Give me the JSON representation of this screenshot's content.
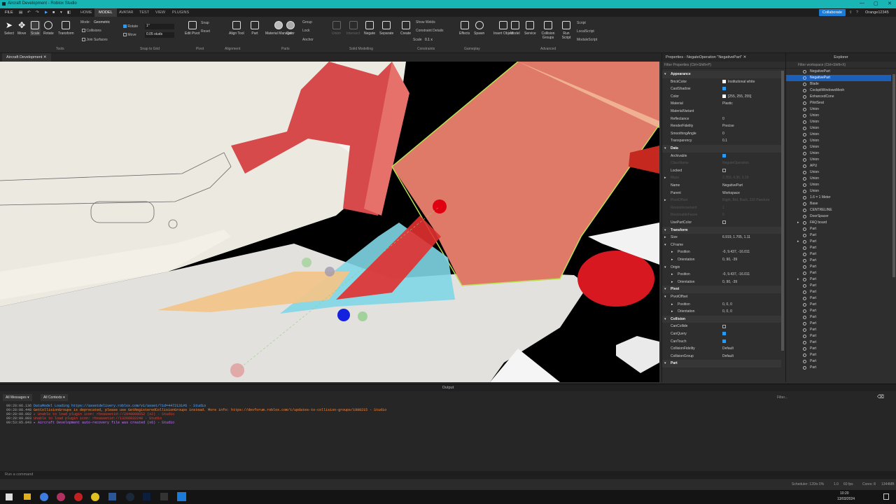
{
  "window": {
    "title": "Aircraft Development - Roblox Studio"
  },
  "menu": {
    "file": "FILE",
    "items": [
      "HOME",
      "MODEL",
      "AVATAR",
      "TEST",
      "VIEW",
      "PLUGINS"
    ],
    "active": "MODEL",
    "collaborate": "Collaborate",
    "user": "Orange12345"
  },
  "ribbon": {
    "tools": [
      "Select",
      "Move",
      "Scale",
      "Rotate",
      "Transform"
    ],
    "mode_label": "Mode:",
    "mode_value": "Geometric",
    "collisions": "Collisions",
    "join_surfaces": "Join Surfaces",
    "rotate_label": "Rotate",
    "rotate_value": "1°",
    "move_label": "Move",
    "move_value": "0.05 studs",
    "edit_pivot": "Edit Pivot",
    "snap": "Snap",
    "reset": "Reset",
    "align_tool": "Align Tool",
    "part": "Part",
    "material_manager": "Material Manager",
    "color": "Color",
    "group": "Group",
    "lock": "Lock",
    "anchor": "Anchor",
    "union": "Union",
    "intersect": "Intersect",
    "negate": "Negate",
    "separate": "Separate",
    "create": "Create",
    "show_welds": "Show Welds",
    "constraint_details": "Constraint Details",
    "scale_label": "Scale",
    "scale_value": "0.1 x",
    "effects": "Effects",
    "spawn": "Spawn",
    "insert_object": "Insert Object",
    "model": "Model",
    "service": "Service",
    "collision_groups": "Collision Groups",
    "run_script": "Run Script",
    "script": "Script",
    "local_script": "LocalScript",
    "module_script": "ModuleScript",
    "groups": [
      "Tools",
      "Snap to Grid",
      "Pivot",
      "Alignment",
      "Parts",
      "Solid Modelling",
      "Constraints",
      "Gameplay",
      "Advanced"
    ]
  },
  "viewport": {
    "tab": "Aircraft Development"
  },
  "properties": {
    "title": "Properties - NegateOperation \"NegativePart\"",
    "filter": "Filter Properties (Ctrl+Shift+P)",
    "rows": [
      {
        "t": "sec",
        "n": "Appearance"
      },
      {
        "n": "BrickColor",
        "v": "Institutional white",
        "sw": "#ffffff"
      },
      {
        "n": "CastShadow",
        "c": true
      },
      {
        "n": "Color",
        "v": "[255, 255, 255]",
        "sw": "#ffffff"
      },
      {
        "n": "Material",
        "v": "Plastic"
      },
      {
        "n": "MaterialVariant",
        "v": ""
      },
      {
        "n": "Reflectance",
        "v": "0"
      },
      {
        "n": "RenderFidelity",
        "v": "Precise"
      },
      {
        "n": "SmoothingAngle",
        "v": "0"
      },
      {
        "n": "Transparency",
        "v": "0.1"
      },
      {
        "t": "sec",
        "n": "Data"
      },
      {
        "n": "Archivable",
        "c": true
      },
      {
        "n": "ClassName",
        "v": "NegateOperation",
        "dim": true
      },
      {
        "n": "Locked",
        "c": false
      },
      {
        "n": "Mass",
        "v": "2.353, 4.36, 3.19",
        "dim": true,
        "x": true
      },
      {
        "n": "Name",
        "v": "NegativePart"
      },
      {
        "n": "Parent",
        "v": "Workspace"
      },
      {
        "n": "PivotOffset",
        "v": "Right, Bot, Back, 226 Pandora",
        "dim": true,
        "x": true
      },
      {
        "n": "ResizeIncrement",
        "v": "1",
        "dim": true
      },
      {
        "n": "ResizeableFaces",
        "v": "0",
        "dim": true
      },
      {
        "n": "UsePartColor",
        "c": false
      },
      {
        "t": "sec",
        "n": "Transform"
      },
      {
        "n": "Size",
        "v": "6.919, 1.705, 1.11",
        "x": true
      },
      {
        "n": "CFrame",
        "v": "",
        "x": true,
        "open": true
      },
      {
        "n": "Position",
        "v": "-0, 9.437, -16.011",
        "sub": true
      },
      {
        "n": "Orientation",
        "v": "0, 90, -39",
        "sub": true
      },
      {
        "n": "Origin",
        "v": "",
        "x": true,
        "open": true
      },
      {
        "n": "Position",
        "v": "-0, 9.437, -16.011",
        "sub": true
      },
      {
        "n": "Orientation",
        "v": "0, 90, -39",
        "sub": true
      },
      {
        "t": "sec",
        "n": "Pivot"
      },
      {
        "n": "PivotOffset",
        "v": "",
        "x": true,
        "open": true
      },
      {
        "n": "Position",
        "v": "0, 0, 0",
        "sub": true
      },
      {
        "n": "Orientation",
        "v": "0, 0, 0",
        "sub": true
      },
      {
        "t": "sec",
        "n": "Collision"
      },
      {
        "n": "CanCollide",
        "c": false
      },
      {
        "n": "CanQuery",
        "c": true
      },
      {
        "n": "CanTouch",
        "c": true
      },
      {
        "n": "CollisionFidelity",
        "v": "Default"
      },
      {
        "n": "CollisionGroup",
        "v": "Default"
      },
      {
        "t": "sec",
        "n": "Part"
      }
    ]
  },
  "explorer": {
    "title": "Explorer",
    "filter": "Filter workspace (Ctrl+Shift+X)",
    "items": [
      "NegativePart",
      "NegativePart",
      "Blade",
      "CockpitWindowsMesh",
      "EnhancedCone",
      "PilotSeat",
      "Union",
      "Union",
      "Union",
      "Union",
      "Union",
      "Union",
      "Union",
      "Union",
      "Union",
      "APU",
      "Union",
      "Union",
      "Union",
      "Union",
      "1.6 = 1 Meter",
      "Base",
      "CENTRELINE",
      "DoorSpacer",
      "FAQ board",
      "Part",
      "Part",
      "Part",
      "Part",
      "Part",
      "Part",
      "Part",
      "Part",
      "Part",
      "Part",
      "Part",
      "Part",
      "Part",
      "Part",
      "Part",
      "Part",
      "Part",
      "Part",
      "Part",
      "Part",
      "Part",
      "Part",
      "Part"
    ],
    "selected": 1
  },
  "output": {
    "title": "Output",
    "all_messages": "All Messages",
    "all_contexts": "All Contexts",
    "filter": "Filter...",
    "lines": [
      {
        "ts": "09:28:06.136",
        "msg": "DataModel Loading https://assetdelivery.roblox.com/v1/asset/?id=4472131#6  -  Studio",
        "c": "#5aa9ff"
      },
      {
        "ts": "09:28:08.448",
        "msg": "GetCollisionGroups is deprecated, please use GetRegisteredCollisionGroups instead. More info: https://devforum.roblox.com/t/updates-to-collision-groups/1990215  -  Studio",
        "c": "#ff8a3d"
      },
      {
        "ts": "09:28:09.002",
        "msg": "  ▸ Unable to load plugin icon: rbxassetid://2049008652 (x2)  -  Studio",
        "c": "#e0453a"
      },
      {
        "ts": "09:28:09.003",
        "msg": "Unable to load plugin icon: rbxassetid://13266032240  -  Studio",
        "c": "#e0453a"
      },
      {
        "ts": "09:53:05.843",
        "msg": "  ▸ Aircraft Development auto-recovery file was created (x6)  -  Studio",
        "c": "#c07bff"
      }
    ],
    "command": "Run a command"
  },
  "status": {
    "scheduler": "Scheduler: 120/s 0%",
    "v1": "1.0",
    "fps": "60 fps",
    "cores": "Cores: 8",
    "mem": "1344MB"
  },
  "taskbar": {
    "time": "10:20",
    "date": "13/03/2024"
  }
}
